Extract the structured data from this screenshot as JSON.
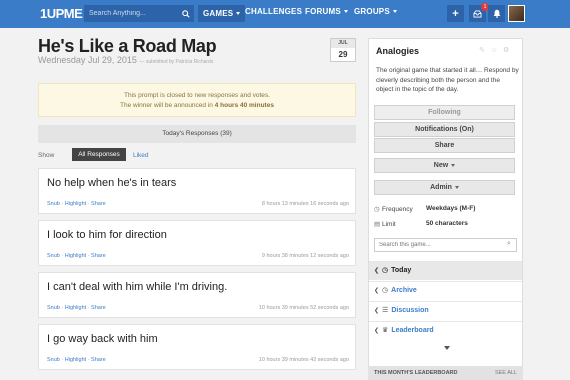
{
  "nav": {
    "logo": "1UPME",
    "search_placeholder": "Search Anything...",
    "games": "GAMES",
    "challenges": "CHALLENGES",
    "forums": "FORUMS",
    "groups": "GROUPS",
    "notif_count": "1",
    "add_label": "+"
  },
  "page": {
    "title": "He's Like a Road Map",
    "date": "Wednesday Jul 29, 2015",
    "submitted_by": "submitted by Patricia Richards",
    "date_month": "JUL",
    "date_day": "29"
  },
  "notice": {
    "line1": "This prompt is closed to new responses and votes.",
    "line2_prefix": "The winner will be announced in ",
    "line2_value": "4 hours 40 minutes"
  },
  "responses": {
    "header": "Today's Responses (39)",
    "show_label": "Show",
    "tab_all": "All Responses",
    "tab_liked": "Liked",
    "actions": {
      "snub": "Snub",
      "highlight": "Highlight",
      "share": "Share",
      "sep": " · "
    },
    "items": [
      {
        "text": "No help when he's in tears",
        "time": "8 hours 13 minutes 16 seconds ago"
      },
      {
        "text": "I look to him for direction",
        "time": "9 hours 38 minutes 12 seconds ago"
      },
      {
        "text": "I can't deal with him while I'm driving.",
        "time": "10 hours 39 minutes 52 seconds ago"
      },
      {
        "text": "I go way back with him",
        "time": "10 hours 39 minutes 42 seconds ago"
      }
    ]
  },
  "panel": {
    "title": "Analogies",
    "description": "The original game that started it all… Respond by cleverly describing both the person and the object in the topic of the day.",
    "buttons": {
      "following": "Following",
      "notifications": "Notifications (On)",
      "share": "Share",
      "new": "New",
      "admin": "Admin"
    },
    "frequency_label": "Frequency",
    "frequency_value": "Weekdays (M-F)",
    "limit_label": "Limit",
    "limit_value": "50 characters",
    "search_placeholder": "Search this game...",
    "nav": {
      "today": "Today",
      "archive": "Archive",
      "discussion": "Discussion",
      "leaderboard": "Leaderboard"
    }
  },
  "leaderboard": {
    "header": "THIS MONTH'S LEADERBOARD",
    "see_all": "SEE ALL"
  },
  "colors": {
    "brand": "#3b7cc9",
    "notice_bg": "#fcf8e3",
    "badge": "#e03a3a"
  }
}
